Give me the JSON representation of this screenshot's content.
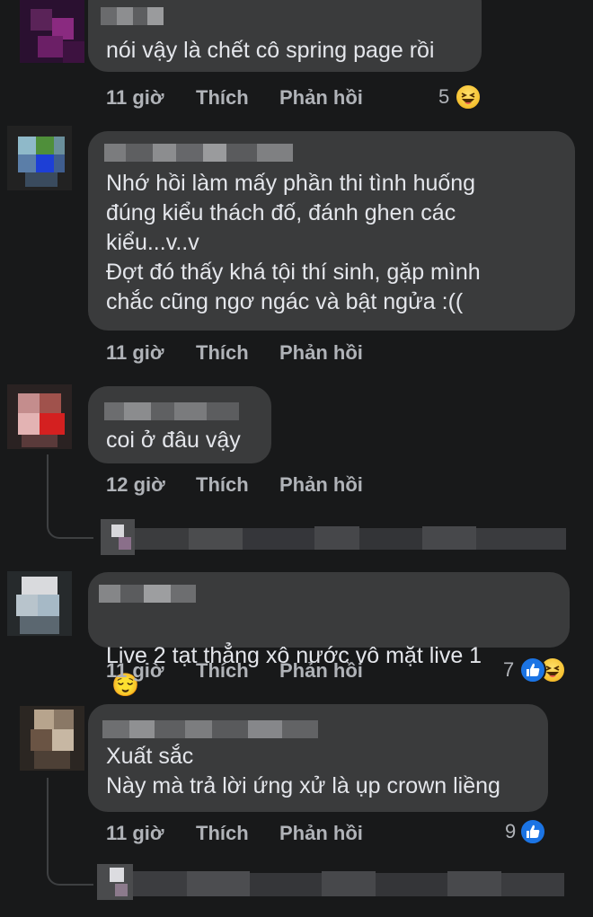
{
  "comments": [
    {
      "text": "nói vậy là chết cô spring page rồi",
      "time": "11 giờ",
      "like_label": "Thích",
      "reply_label": "Phản hồi",
      "reaction_count": "5",
      "reactions": [
        "haha-icon"
      ]
    },
    {
      "text": "Nhớ hồi làm mấy phần thi tình huống\nđúng kiểu thách đố, đánh ghen các\nkiểu...v..v\nĐợt đó thấy khá tội thí sinh, gặp mình\nchắc cũng ngơ ngác và bật ngửa :((",
      "time": "11 giờ",
      "like_label": "Thích",
      "reply_label": "Phản hồi"
    },
    {
      "text": "coi ở đâu vậy",
      "time": "12 giờ",
      "like_label": "Thích",
      "reply_label": "Phản hồi"
    },
    {
      "text": "Live 2 tạt thẳng xô nước vô  mặt live 1",
      "emoji": "😌",
      "time": "11 giờ",
      "like_label": "Thích",
      "reply_label": "Phản hồi",
      "reaction_count": "7",
      "reactions": [
        "like-icon",
        "haha-icon"
      ]
    },
    {
      "text": "Xuất sắc\nNày mà trả lời ứng xử là ụp crown liềng",
      "time": "11 giờ",
      "like_label": "Thích",
      "reply_label": "Phản hồi",
      "reaction_count": "9",
      "reactions": [
        "like-icon"
      ]
    }
  ],
  "colors": {
    "background": "#18191a",
    "bubble": "#3a3b3c",
    "text": "#e4e6eb",
    "meta": "#b0b3b8",
    "like_blue": "#1b74e4",
    "haha_yellow": "#f6c232"
  }
}
